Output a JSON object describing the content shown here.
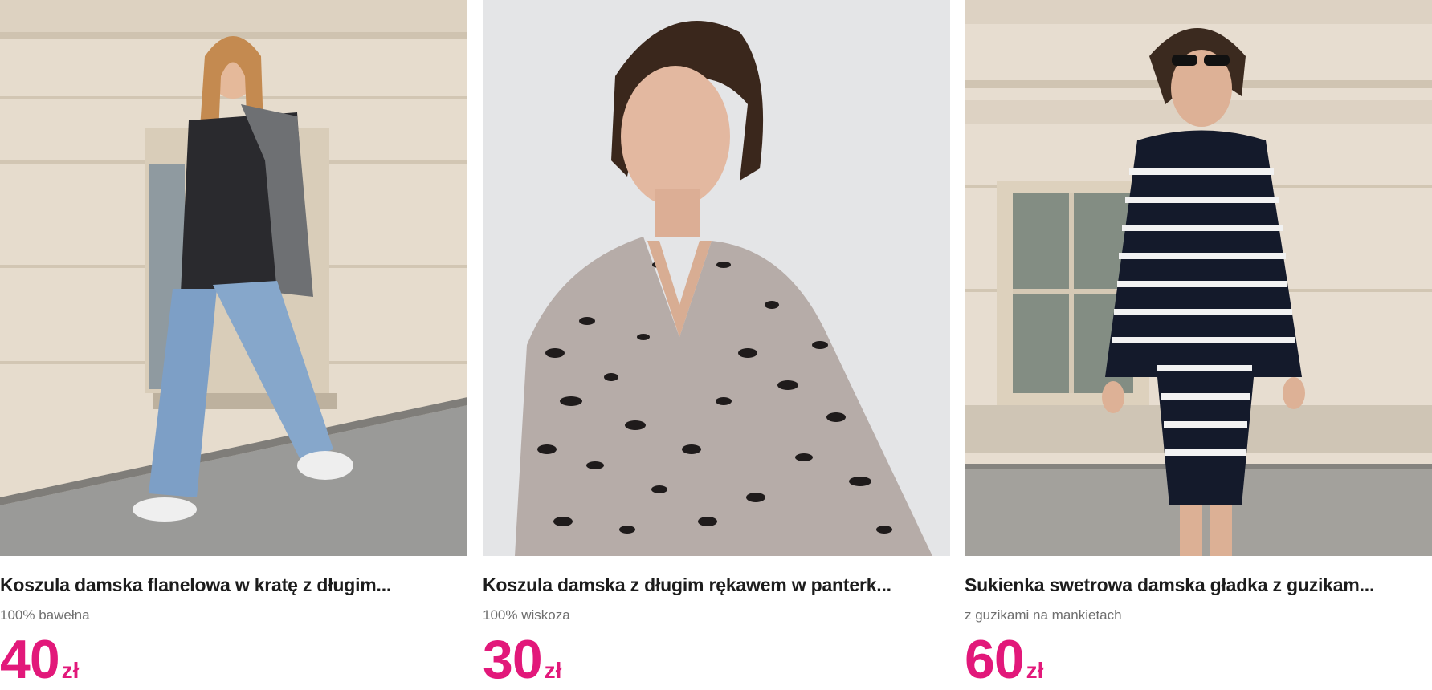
{
  "products": [
    {
      "title": "Koszula damska flanelowa w kratę z długim...",
      "subtitle": "100% bawełna",
      "price": "40",
      "currency": "zł"
    },
    {
      "title": "Koszula damska z długim rękawem w panterk...",
      "subtitle": "100% wiskoza",
      "price": "30",
      "currency": "zł"
    },
    {
      "title": "Sukienka swetrowa damska gładka z guzikam...",
      "subtitle": "z guzikami na mankietach",
      "price": "60",
      "currency": "zł"
    }
  ],
  "colors": {
    "price": "#e2187a",
    "title": "#1c1c1c",
    "subtitle": "#6f6f6f"
  }
}
